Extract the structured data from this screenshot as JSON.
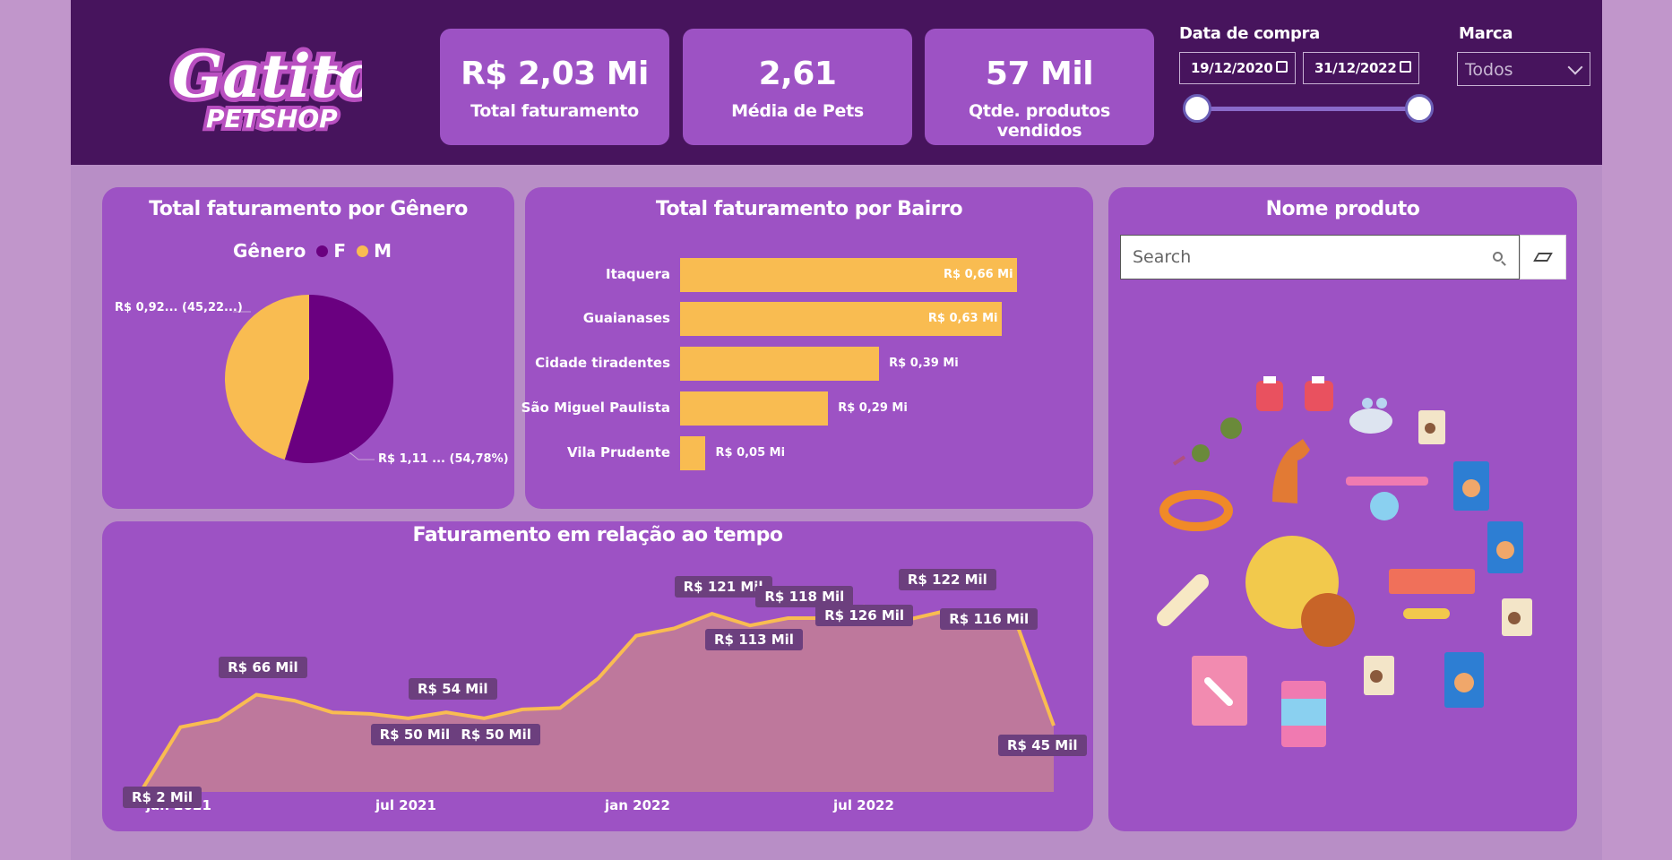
{
  "logo": {
    "line1": "Gatito",
    "line2": "PETSHOP"
  },
  "kpis": [
    {
      "value": "R$ 2,03 Mi",
      "label": "Total faturamento"
    },
    {
      "value": "2,61",
      "label": "Média de Pets"
    },
    {
      "value": "57 Mil",
      "label": "Qtde. produtos vendidos"
    }
  ],
  "date_slicer": {
    "title": "Data de compra",
    "start": "19/12/2020",
    "end": "31/12/2022"
  },
  "brand_slicer": {
    "title": "Marca",
    "selected": "Todos"
  },
  "gender_card": {
    "title": "Total faturamento por Gênero",
    "legend_title": "Gênero",
    "legend_f": "F",
    "legend_m": "M",
    "label_m": "R$ 0,92... (45,22...)",
    "label_f": "R$ 1,11 ... (54,78%)"
  },
  "bairro_card": {
    "title": "Total faturamento por Bairro"
  },
  "product_card": {
    "title": "Nome produto",
    "search_placeholder": "Search"
  },
  "time_card": {
    "title": "Faturamento em relação ao tempo",
    "x_ticks": [
      "jan 2021",
      "jul 2021",
      "jan 2022",
      "jul 2022"
    ]
  },
  "colors": {
    "female": "#6a0080",
    "male": "#f9bc51",
    "header": "#47145d",
    "card": "#9d52c4"
  },
  "chart_data": [
    {
      "type": "pie",
      "title": "Total faturamento por Gênero",
      "labels": [
        "F",
        "M"
      ],
      "values": [
        1.11,
        0.92
      ],
      "percent": [
        54.78,
        45.22
      ]
    },
    {
      "type": "bar",
      "title": "Total faturamento por Bairro",
      "categories": [
        "Itaquera",
        "Guaianases",
        "Cidade tiradentes",
        "São Miguel Paulista",
        "Vila Prudente"
      ],
      "values": [
        0.66,
        0.63,
        0.39,
        0.29,
        0.05
      ],
      "value_labels": [
        "R$ 0,66 Mi",
        "R$ 0,63 Mi",
        "R$ 0,39 Mi",
        "R$ 0,29 Mi",
        "R$ 0,05 Mi"
      ]
    },
    {
      "type": "area",
      "title": "Faturamento em relação ao tempo",
      "x": [
        "2020-12",
        "2021-01",
        "2021-02",
        "2021-03",
        "2021-04",
        "2021-05",
        "2021-06",
        "2021-07",
        "2021-08",
        "2021-09",
        "2021-10",
        "2021-11",
        "2021-12",
        "2022-01",
        "2022-02",
        "2022-03",
        "2022-04",
        "2022-05",
        "2022-06",
        "2022-07",
        "2022-08",
        "2022-09",
        "2022-10",
        "2022-11",
        "2022-12"
      ],
      "values": [
        2,
        44,
        49,
        66,
        62,
        54,
        53,
        50,
        54,
        50,
        56,
        57,
        77,
        106,
        111,
        121,
        113,
        118,
        118,
        126,
        116,
        122,
        116,
        116,
        45
      ],
      "data_labels": [
        {
          "index": 0,
          "text": "R$ 2 Mil"
        },
        {
          "index": 3,
          "text": "R$ 66 Mil"
        },
        {
          "index": 7,
          "text": "R$ 50 Mil"
        },
        {
          "index": 8,
          "text": "R$ 54 Mil"
        },
        {
          "index": 9,
          "text": "R$ 50 Mil"
        },
        {
          "index": 15,
          "text": "R$ 121 Mil"
        },
        {
          "index": 16,
          "text": "R$ 113 Mil"
        },
        {
          "index": 17,
          "text": "R$ 118 Mil"
        },
        {
          "index": 19,
          "text": "R$ 126 Mil"
        },
        {
          "index": 21,
          "text": "R$ 122 Mil"
        },
        {
          "index": 22,
          "text": "R$ 116 Mil"
        },
        {
          "index": 24,
          "text": "R$ 45 Mil"
        }
      ],
      "ylim": [
        0,
        140
      ]
    }
  ]
}
